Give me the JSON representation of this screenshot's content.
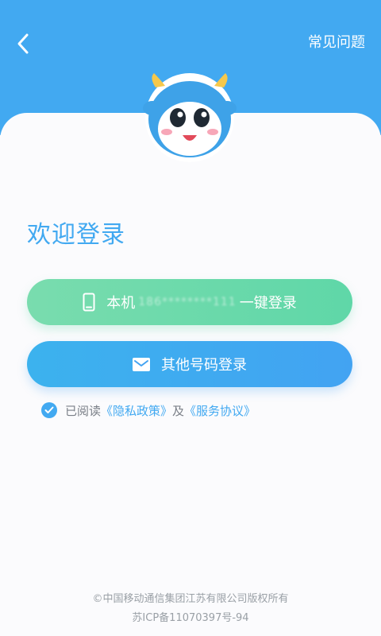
{
  "header": {
    "back_icon": "chevron-left-icon",
    "faq_label": "常见问题"
  },
  "main": {
    "welcome_title": "欢迎登录",
    "local_login": {
      "icon": "phone-icon",
      "prefix": "本机",
      "masked_number": "186********111",
      "suffix": "一键登录"
    },
    "other_login": {
      "icon": "mail-icon",
      "label": "其他号码登录"
    },
    "agreement": {
      "checked": true,
      "prefix": "已阅读",
      "privacy_link": "《隐私政策》",
      "and": "及",
      "service_link": "《服务协议》"
    }
  },
  "footer": {
    "copyright": "©中国移动通信集团江苏有限公司版权所有",
    "icp": "苏ICP备11070397号-94"
  },
  "colors": {
    "primary": "#42a9f1",
    "green": "#5fd7a8",
    "muted": "#9aa0a6"
  }
}
